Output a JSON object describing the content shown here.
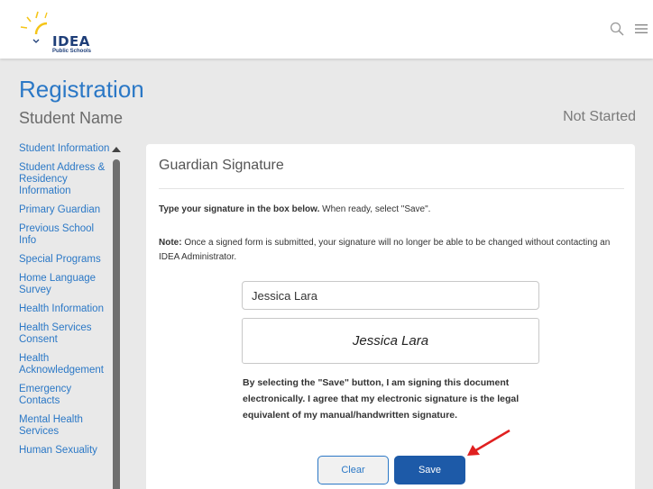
{
  "header": {
    "logo_name": "IDEA",
    "logo_sub": "Public Schools",
    "search_icon": "search-icon",
    "menu_icon": "hamburger-menu-icon"
  },
  "page": {
    "title": "Registration",
    "student_name": "Student Name",
    "status": "Not Started"
  },
  "sidebar": {
    "items": [
      {
        "label": "Student Information"
      },
      {
        "label": "Student Address & Residency Information"
      },
      {
        "label": "Primary Guardian"
      },
      {
        "label": "Previous School Info"
      },
      {
        "label": "Special Programs"
      },
      {
        "label": "Home Language Survey"
      },
      {
        "label": "Health Information"
      },
      {
        "label": "Health Services Consent"
      },
      {
        "label": "Health Acknowledgement"
      },
      {
        "label": "Emergency Contacts"
      },
      {
        "label": "Mental Health Services"
      },
      {
        "label": "Human Sexuality"
      }
    ]
  },
  "card": {
    "title": "Guardian Signature",
    "instruction_bold": "Type your signature in the box below.",
    "instruction_rest": " When ready, select \"Save\".",
    "note_label": "Note:",
    "note_text": " Once a signed form is submitted, your signature will no longer be able to be changed without contacting an IDEA Administrator.",
    "signature_value": "Jessica Lara",
    "signature_preview": "Jessica Lara",
    "consent": "By selecting the \"Save\" button, I am signing this document electronically. I agree that my electronic signature is the legal equivalent of my manual/handwritten signature.",
    "clear_label": "Clear",
    "save_label": "Save"
  },
  "colors": {
    "accent": "#2b78c6",
    "save_button": "#1d5aa8",
    "annotation": "#e02020",
    "logo_sun": "#f5c518"
  }
}
